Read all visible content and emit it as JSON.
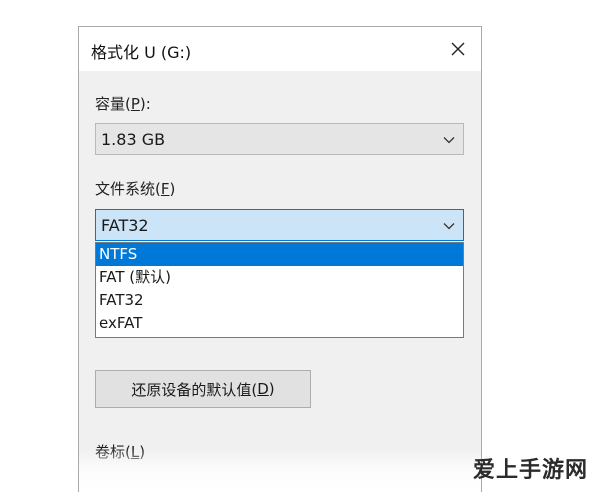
{
  "dialog": {
    "title": "格式化 U (G:)",
    "capacity": {
      "label": "容量(",
      "accesskey": "P",
      "label_end": "):",
      "value": "1.83 GB"
    },
    "filesystem": {
      "label": "文件系统(",
      "accesskey": "F",
      "label_end": ")",
      "value": "FAT32",
      "options": [
        "NTFS",
        "FAT (默认)",
        "FAT32",
        "exFAT"
      ],
      "highlighted_index": 0
    },
    "restore_button": {
      "label": "还原设备的默认值(",
      "accesskey": "D",
      "label_end": ")"
    },
    "volume_label": {
      "label": "卷标(",
      "accesskey": "L",
      "label_end": ")"
    }
  },
  "watermark": "爱上手游网",
  "colors": {
    "accent": "#0078d7",
    "dialog_bg": "#f0f0f0",
    "select_active_bg": "#cce4f7"
  },
  "icons": {
    "close": "close-icon",
    "chevron": "chevron-down-icon"
  }
}
